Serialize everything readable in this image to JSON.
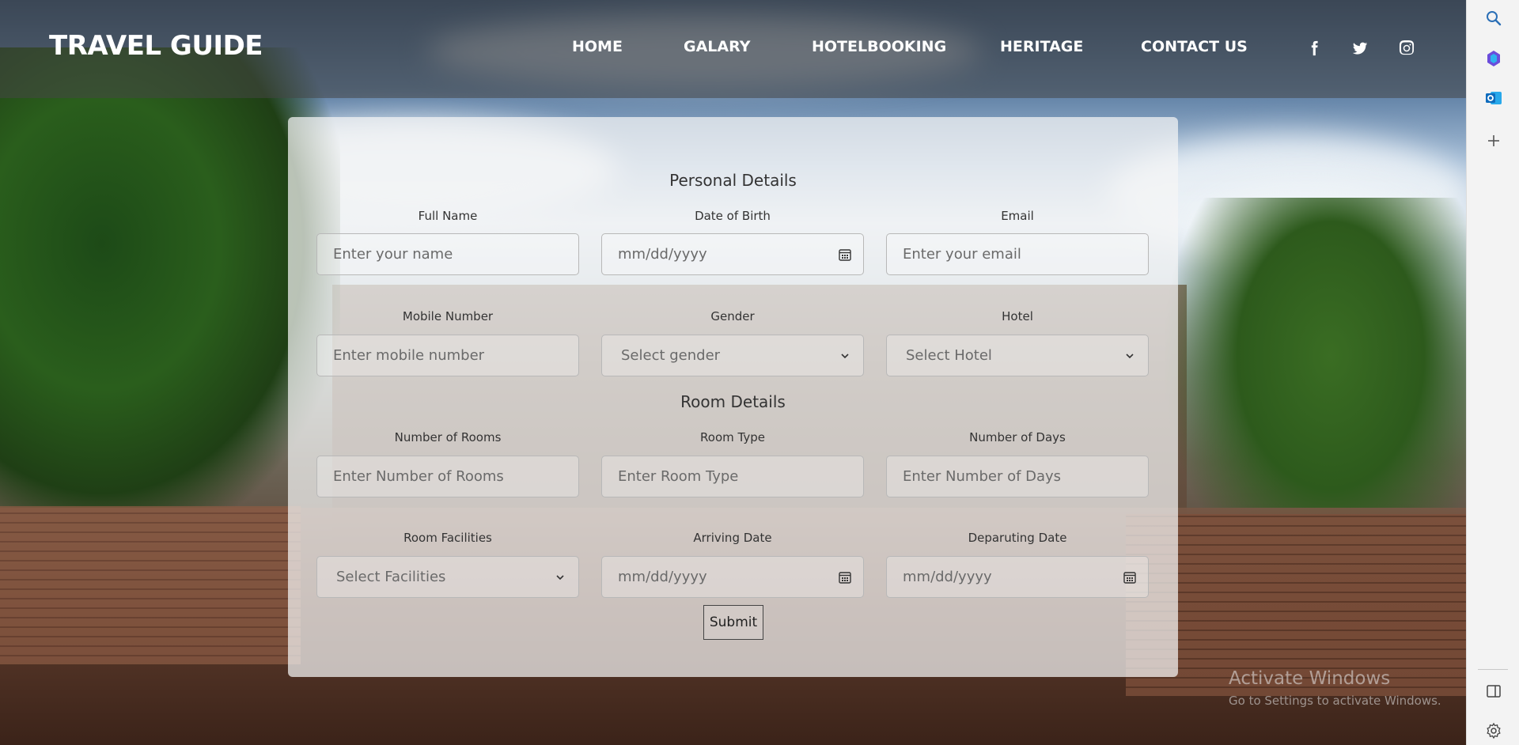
{
  "header": {
    "brand": "TRAVEL GUIDE",
    "nav": [
      {
        "label": "HOME"
      },
      {
        "label": "GALARY"
      },
      {
        "label": "HOTELBOOKING"
      },
      {
        "label": "HERITAGE"
      },
      {
        "label": "CONTACT US"
      }
    ],
    "social": [
      {
        "icon": "facebook-icon"
      },
      {
        "icon": "twitter-icon"
      },
      {
        "icon": "instagram-icon"
      }
    ]
  },
  "form": {
    "personal_title": "Personal Details",
    "room_title": "Room Details",
    "fields": {
      "full_name": {
        "label": "Full Name",
        "placeholder": "Enter your name"
      },
      "dob": {
        "label": "Date of Birth",
        "placeholder": "mm/dd/yyyy"
      },
      "email": {
        "label": "Email",
        "placeholder": "Enter your email"
      },
      "mobile": {
        "label": "Mobile Number",
        "placeholder": "Enter mobile number"
      },
      "gender": {
        "label": "Gender",
        "selected": "Select gender"
      },
      "hotel": {
        "label": "Hotel",
        "selected": "Select Hotel"
      },
      "rooms": {
        "label": "Number of Rooms",
        "placeholder": "Enter Number of Rooms"
      },
      "room_type": {
        "label": "Room Type",
        "placeholder": "Enter Room Type"
      },
      "days": {
        "label": "Number of Days",
        "placeholder": "Enter Number of Days"
      },
      "facilities": {
        "label": "Room Facilities",
        "selected": "Select Facilities"
      },
      "arriving": {
        "label": "Arriving Date",
        "placeholder": "mm/dd/yyyy"
      },
      "departing": {
        "label": "Deparuting Date",
        "placeholder": "mm/dd/yyyy"
      }
    },
    "submit_label": "Submit"
  },
  "side_panel": {
    "icons": [
      "search-icon",
      "copilot-icon",
      "outlook-icon",
      "add-icon",
      "sidebar-toggle-icon",
      "settings-icon"
    ]
  },
  "watermark": {
    "title": "Activate Windows",
    "subtitle": "Go to Settings to activate Windows."
  },
  "colors": {
    "header_overlay": "#464646",
    "card_bg": "#f5f5f5",
    "text": "#333333",
    "outlook_blue": "#0f6cbd"
  }
}
